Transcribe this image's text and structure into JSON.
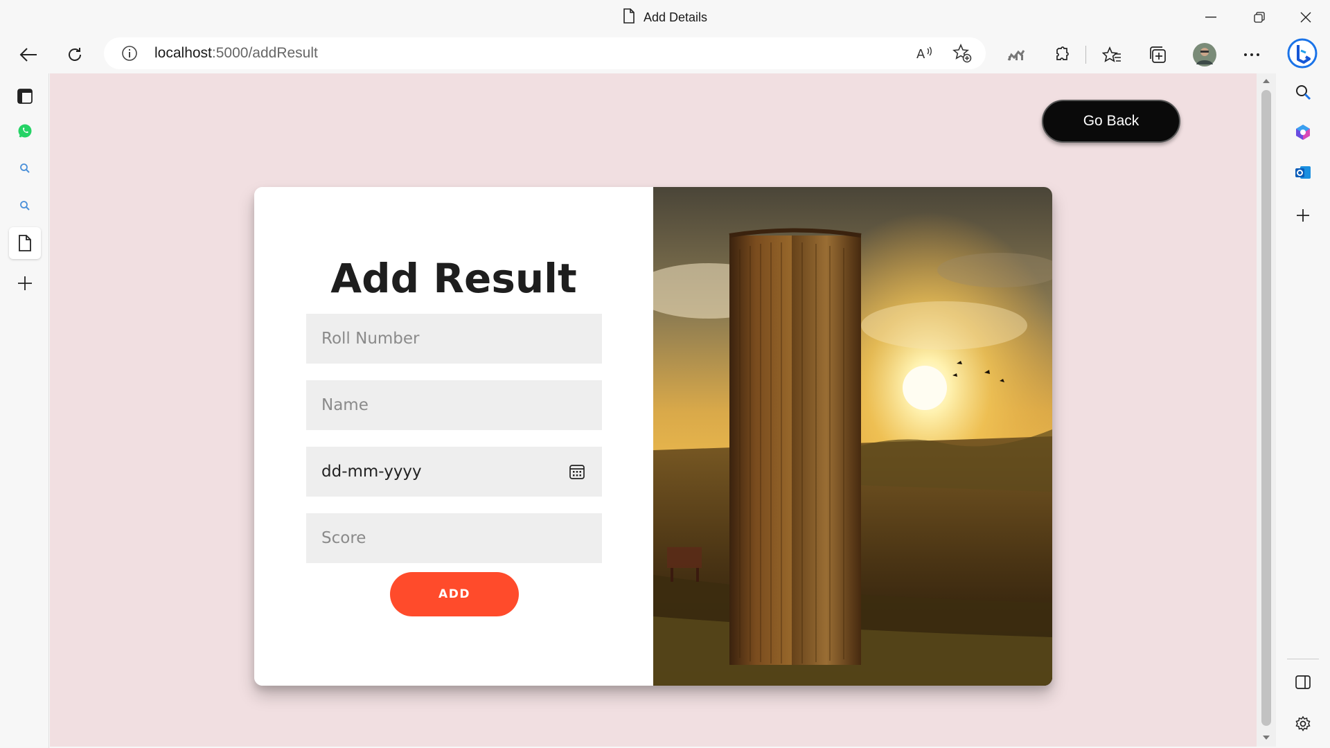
{
  "window": {
    "title": "Add Details"
  },
  "browser": {
    "url_host": "localhost",
    "url_path": ":5000/addResult"
  },
  "page": {
    "go_back_label": "Go Back",
    "form": {
      "title": "Add Result",
      "roll_placeholder": "Roll Number",
      "name_placeholder": "Name",
      "date_value": "dd-mm-yyyy",
      "score_placeholder": "Score",
      "add_label": "ADD"
    }
  },
  "colors": {
    "page_background": "#f1dfe1",
    "accent_button": "#ff4b2b",
    "go_back_button": "#0a0a0a"
  }
}
